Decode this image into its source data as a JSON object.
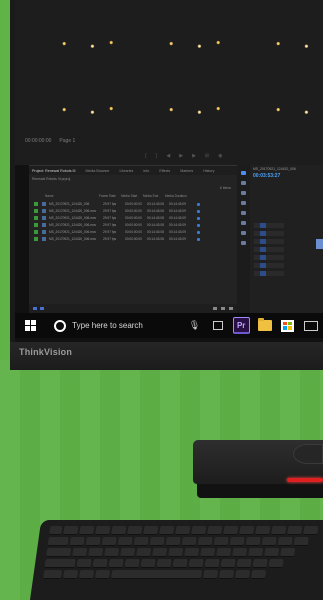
{
  "brand": "ThinkVision",
  "taskbar": {
    "search_placeholder": "Type here to search",
    "premiere_label": "Pr"
  },
  "premiere": {
    "project_tabs": [
      "Project: Renewal Robots III",
      "Media Browser",
      "Libraries",
      "Info",
      "Effects",
      "Markers",
      "History"
    ],
    "project_path": "Renewal Robots III.prproj",
    "item_count": "6 Items",
    "columns": [
      "Name",
      "Frame Rate",
      "Media Start",
      "Media End",
      "Media Duration"
    ],
    "files": [
      {
        "name": "MS_20170921_124420_006",
        "fps": "29.97 fps",
        "start": "00:00:00:00",
        "end": "00:14:43:08",
        "dur": "00:14:43:09"
      },
      {
        "name": "MS_20170921_124420_006.mov",
        "fps": "29.97 fps",
        "start": "00:00:00:00",
        "end": "00:14:43:08",
        "dur": "00:14:43:09"
      },
      {
        "name": "MS_20170921_124420_006.mov",
        "fps": "29.97 fps",
        "start": "00:00:00:00",
        "end": "00:14:43:08",
        "dur": "00:14:43:09"
      },
      {
        "name": "MS_20170921_124420_006.mov",
        "fps": "29.97 fps",
        "start": "00:00:00:00",
        "end": "00:14:43:08",
        "dur": "00:14:43:09"
      },
      {
        "name": "MS_20170921_124420_006.mov",
        "fps": "29.97 fps",
        "start": "00:00:00:00",
        "end": "00:14:43:08",
        "dur": "00:14:43:09"
      },
      {
        "name": "MS_20170921_124420_006.mov",
        "fps": "29.97 fps",
        "start": "00:00:00:00",
        "end": "00:14:43:08",
        "dur": "00:14:43:09"
      }
    ],
    "timeline_tab": "MS_20170921_124420_006",
    "timecode": "00:03:53:27",
    "source_timecode": "00:00:00:00",
    "fit_label": "Page 1"
  }
}
